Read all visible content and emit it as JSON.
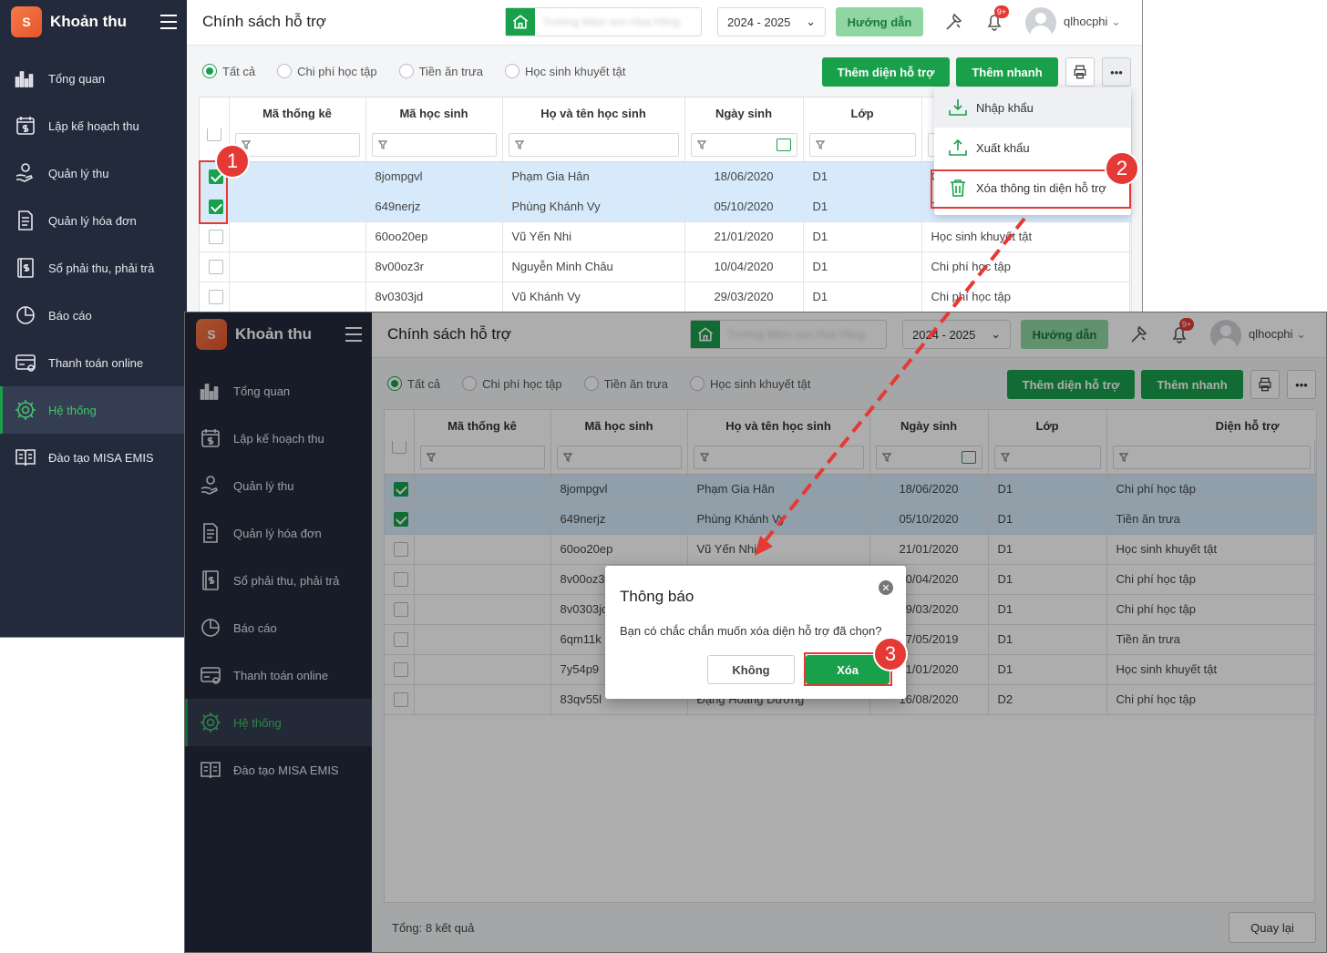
{
  "app": {
    "name": "Khoản thu",
    "logo": "S"
  },
  "nav": [
    {
      "label": "Tổng quan",
      "icon": "chart-icon"
    },
    {
      "label": "Lập kế hoạch thu",
      "icon": "calendar-money-icon"
    },
    {
      "label": "Quản lý thu",
      "icon": "hand-coin-icon"
    },
    {
      "label": "Quản lý hóa đơn",
      "icon": "invoice-icon"
    },
    {
      "label": "Sổ phải thu, phải trả",
      "icon": "ledger-icon"
    },
    {
      "label": "Báo cáo",
      "icon": "pie-icon"
    },
    {
      "label": "Thanh toán online",
      "icon": "card-icon"
    },
    {
      "label": "Hệ thống",
      "icon": "gear-icon"
    },
    {
      "label": "Đào tạo MISA EMIS",
      "icon": "book-icon"
    }
  ],
  "header": {
    "title": "Chính sách hỗ trợ",
    "school_name": "Trường Mầm non Hoa Hồng",
    "year": "2024 - 2025",
    "guide": "Hướng dẫn",
    "notify_count": "9+",
    "user": "qlhocphi"
  },
  "filters": [
    "Tất cả",
    "Chi phí học tập",
    "Tiền ăn trưa",
    "Học sinh khuyết tật"
  ],
  "actions": {
    "add_type": "Thêm diện hỗ trợ",
    "quick_add": "Thêm nhanh",
    "more": "•••"
  },
  "columns": [
    "Mã thống kê",
    "Mã học sinh",
    "Họ và tên học sinh",
    "Ngày sinh",
    "Lớp",
    "Diện hỗ trợ"
  ],
  "rows": [
    {
      "code": "8jompgvl",
      "name": "Phạm Gia Hân",
      "dob": "18/06/2020",
      "class": "D1",
      "type": "Chi phí học tập",
      "checked": true
    },
    {
      "code": "649nerjz",
      "name": "Phùng Khánh Vy",
      "dob": "05/10/2020",
      "class": "D1",
      "type": "Tiền ăn trưa",
      "checked": true
    },
    {
      "code": "60oo20ep",
      "name": "Vũ Yến Nhi",
      "dob": "21/01/2020",
      "class": "D1",
      "type": "Học sinh khuyết tật",
      "checked": false
    },
    {
      "code": "8v00oz3r",
      "name": "Nguyễn Minh Châu",
      "dob": "10/04/2020",
      "class": "D1",
      "type": "Chi phí học tập",
      "checked": false
    },
    {
      "code": "8v0303jd",
      "name": "Vũ Khánh Vy",
      "dob": "29/03/2020",
      "class": "D1",
      "type": "Chi phí học tập",
      "checked": false
    },
    {
      "code": "6qm11k",
      "name": "",
      "dob": "17/05/2019",
      "class": "D1",
      "type": "Tiền ăn trưa",
      "checked": false
    },
    {
      "code": "7y54p9",
      "name": "",
      "dob": "01/01/2020",
      "class": "D1",
      "type": "Học sinh khuyết tật",
      "checked": false
    },
    {
      "code": "83qv55l",
      "name": "Đặng Hoàng Dương",
      "dob": "16/08/2020",
      "class": "D2",
      "type": "Chi phí học tập",
      "checked": false
    }
  ],
  "menu": [
    "Nhập khẩu",
    "Xuất khẩu",
    "Xóa thông tin diện hỗ trợ"
  ],
  "footer": {
    "total": "Tổng: 8 kết quả",
    "back": "Quay lại"
  },
  "dialog": {
    "title": "Thông báo",
    "message": "Bạn có chắc chắn muốn xóa diện hỗ trợ đã chọn?",
    "no": "Không",
    "yes": "Xóa"
  },
  "steps": [
    "1",
    "2",
    "3"
  ],
  "colors": {
    "sidebar": "#232a3b",
    "accent": "#19a04a",
    "highlight": "#e53935",
    "selected_row": "#d6eafb"
  }
}
